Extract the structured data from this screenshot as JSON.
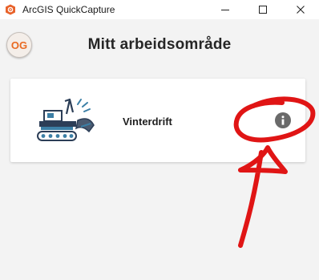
{
  "window": {
    "title": "ArcGIS QuickCapture"
  },
  "header": {
    "avatar_initials": "OG",
    "title": "Mitt arbeidsområde"
  },
  "projects": [
    {
      "name": "Vinterdrift",
      "icon": "snowplow-icon"
    }
  ],
  "colors": {
    "accent": "#e96a22",
    "annotation": "#e01515"
  }
}
